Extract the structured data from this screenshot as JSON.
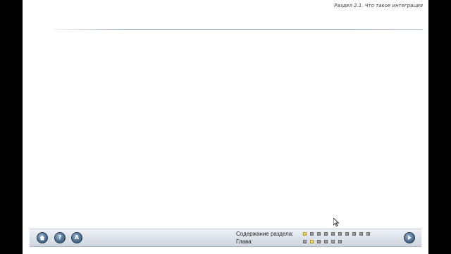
{
  "header": {
    "section_title": "Раздел 2.1. Что такое интеграция"
  },
  "nav": {
    "buttons": [
      {
        "name": "home",
        "icon": "home-icon"
      },
      {
        "name": "help",
        "icon": "question-icon",
        "glyph": "?"
      },
      {
        "name": "a",
        "icon": "letter-a-icon",
        "glyph": "A"
      }
    ],
    "next_icon": "play-arrow-icon"
  },
  "progress": {
    "section_contents_label": "Содержание раздела:",
    "chapter_label": "Глава:",
    "section_contents": {
      "total": 10,
      "active": 1
    },
    "chapter": {
      "total": 6,
      "active": 2
    }
  },
  "colors": {
    "accent": "#4f6f93",
    "active_marker": "#e4c62a",
    "inactive_marker": "#8a8a8a"
  }
}
